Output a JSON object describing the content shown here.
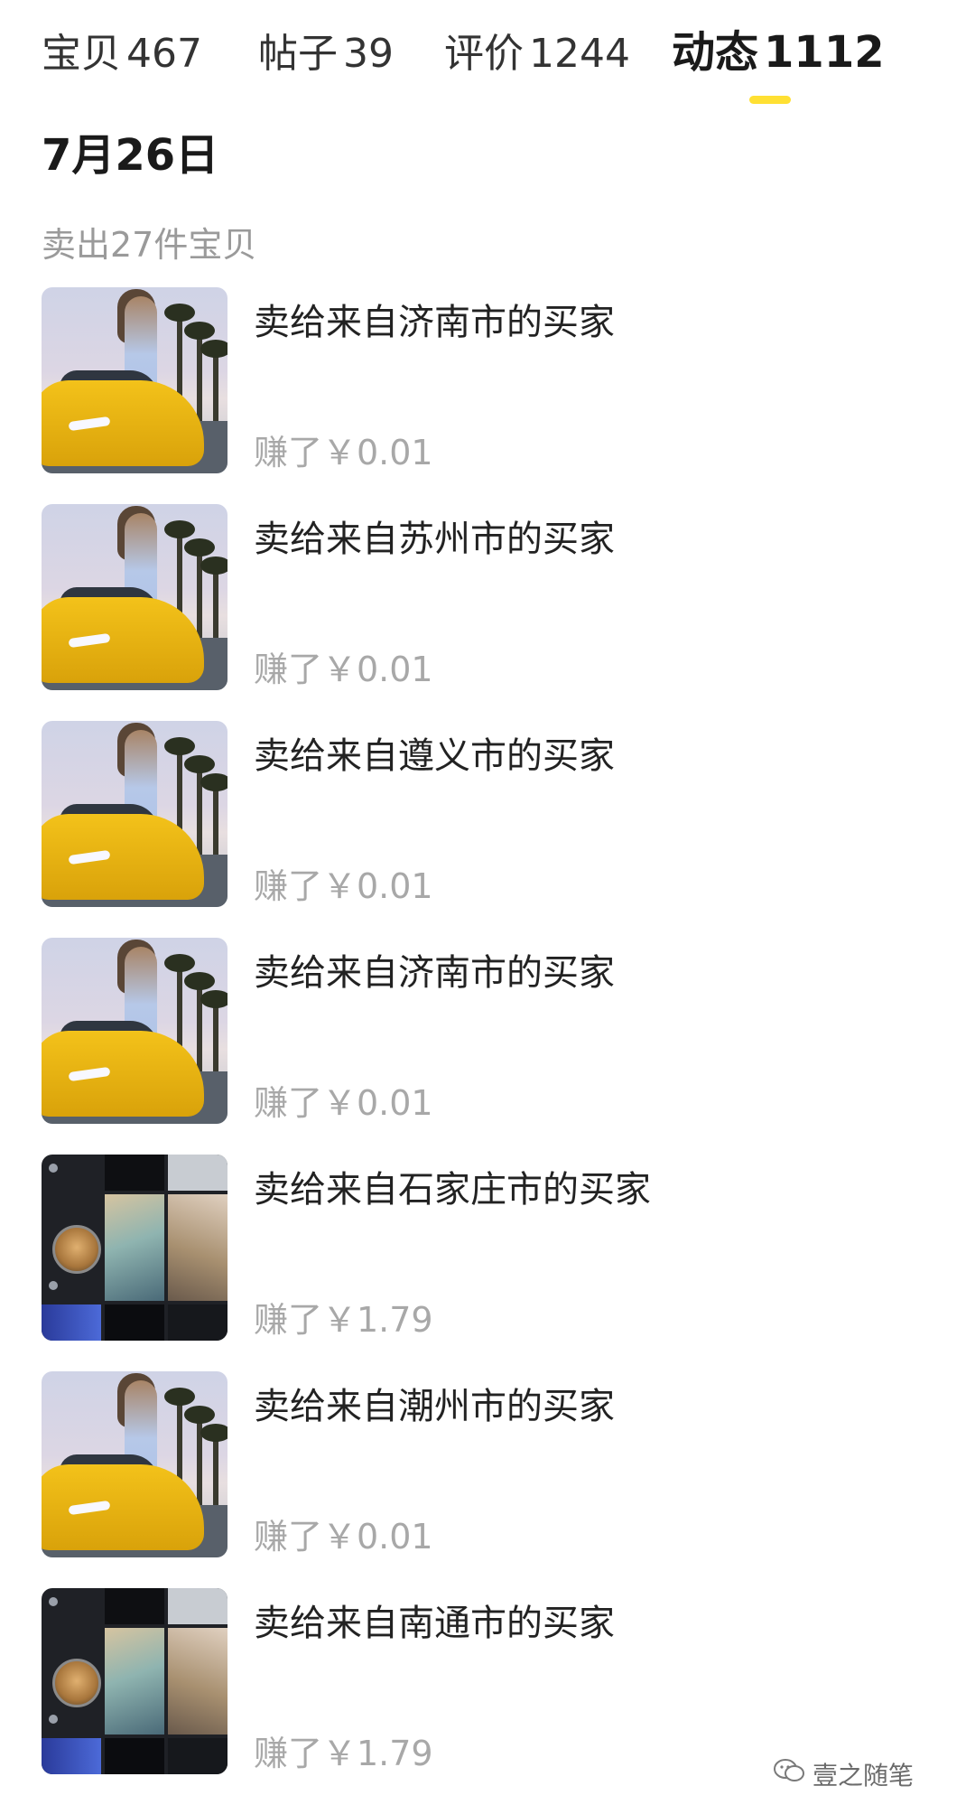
{
  "tabs": [
    {
      "label": "宝贝",
      "count": "467",
      "active": false
    },
    {
      "label": "帖子",
      "count": "39",
      "active": false
    },
    {
      "label": "评价",
      "count": "1244",
      "active": false
    },
    {
      "label": "动态",
      "count": "1112",
      "active": true
    }
  ],
  "colors": {
    "accent": "#FFE033",
    "muted_text": "#a8a8a8",
    "primary_text": "#222222"
  },
  "date_header": "7月26日",
  "section_label": "卖出27件宝贝",
  "items": [
    {
      "title": "卖给来自济南市的买家",
      "earning": "赚了￥0.01",
      "thumbnail": "car-photo"
    },
    {
      "title": "卖给来自苏州市的买家",
      "earning": "赚了￥0.01",
      "thumbnail": "car-photo"
    },
    {
      "title": "卖给来自遵义市的买家",
      "earning": "赚了￥0.01",
      "thumbnail": "car-photo"
    },
    {
      "title": "卖给来自济南市的买家",
      "earning": "赚了￥0.01",
      "thumbnail": "car-photo"
    },
    {
      "title": "卖给来自石家庄市的买家",
      "earning": "赚了￥1.79",
      "thumbnail": "video-grid"
    },
    {
      "title": "卖给来自潮州市的买家",
      "earning": "赚了￥0.01",
      "thumbnail": "car-photo"
    },
    {
      "title": "卖给来自南通市的买家",
      "earning": "赚了￥1.79",
      "thumbnail": "video-grid"
    }
  ],
  "watermark": "壹之随笔"
}
